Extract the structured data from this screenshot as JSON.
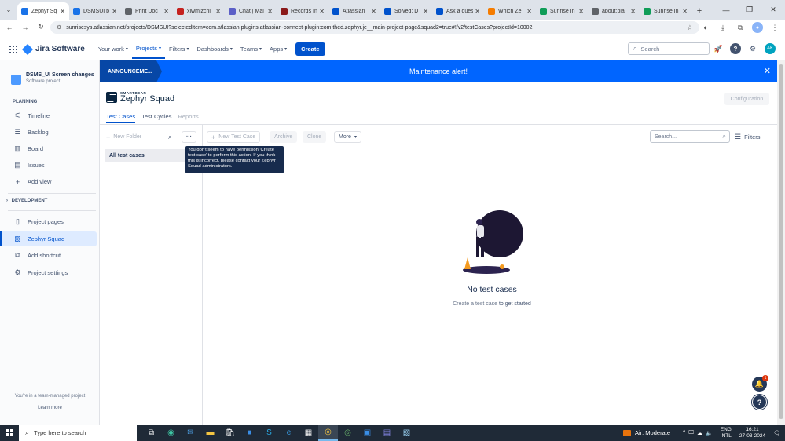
{
  "browser": {
    "tabs": [
      {
        "title": "Zephyr Sq",
        "active": true,
        "fav_color": "#1a73e8"
      },
      {
        "title": "DSMSUI b",
        "active": false,
        "fav_color": "#1a73e8"
      },
      {
        "title": "Print Doc",
        "active": false,
        "fav_color": "#5f6368"
      },
      {
        "title": "xlwmlzchi",
        "active": false,
        "fav_color": "#c5221f"
      },
      {
        "title": "Chat | Mai",
        "active": false,
        "fav_color": "#5b5fc7"
      },
      {
        "title": "Records In",
        "active": false,
        "fav_color": "#8b1a1a"
      },
      {
        "title": "Atlassian",
        "active": false,
        "fav_color": "#0052cc"
      },
      {
        "title": "Solved: D",
        "active": false,
        "fav_color": "#0052cc"
      },
      {
        "title": "Ask a ques",
        "active": false,
        "fav_color": "#0052cc"
      },
      {
        "title": "Which Ze",
        "active": false,
        "fav_color": "#f57c00"
      },
      {
        "title": "Sunrise In",
        "active": false,
        "fav_color": "#0f9d58"
      },
      {
        "title": "about:bla",
        "active": false,
        "fav_color": "#5f6368"
      },
      {
        "title": "Sunrise In",
        "active": false,
        "fav_color": "#0f9d58"
      }
    ],
    "url": "sunrisesys.atlassian.net/projects/DSMSUI?selectedItem=com.atlassian.plugins.atlassian-connect-plugin:com.thed.zephyr.je__main-project-page&squad2=true#!/v2/testCases?projectId=10002"
  },
  "jira": {
    "product": "Jira Software",
    "menu": [
      "Your work",
      "Projects",
      "Filters",
      "Dashboards",
      "Teams",
      "Apps"
    ],
    "active_menu": "Projects",
    "create": "Create",
    "search_placeholder": "Search",
    "user_initials": "AK"
  },
  "sidebar": {
    "project_name": "DSMS_UI Screen changes",
    "project_type": "Software project",
    "planning_heading": "PLANNING",
    "planning_items": [
      {
        "label": "Timeline",
        "icon": "timeline-icon"
      },
      {
        "label": "Backlog",
        "icon": "backlog-icon"
      },
      {
        "label": "Board",
        "icon": "board-icon"
      },
      {
        "label": "Issues",
        "icon": "issues-icon"
      },
      {
        "label": "Add view",
        "icon": "plus-icon"
      }
    ],
    "development_heading": "DEVELOPMENT",
    "other_items": [
      {
        "label": "Project pages",
        "icon": "page-icon"
      },
      {
        "label": "Zephyr Squad",
        "icon": "zephyr-icon",
        "active": true
      },
      {
        "label": "Add shortcut",
        "icon": "shortcut-icon"
      },
      {
        "label": "Project settings",
        "icon": "gear-icon"
      }
    ],
    "footer_text": "You're in a team-managed project",
    "learn_more": "Learn more"
  },
  "announcement": {
    "tag": "ANNOUNCEME...",
    "message": "Maintenance alert!"
  },
  "zephyr": {
    "brand_small": "SMARTBEAR",
    "brand": "Zephyr Squad",
    "configuration": "Configuration",
    "tabs": [
      "Test Cases",
      "Test Cycles",
      "Reports"
    ],
    "new_folder": "New Folder",
    "all_test_cases": "All test cases",
    "new_test_case": "New Test Case",
    "archive": "Archive",
    "clone": "Clone",
    "more": "More",
    "tooltip": "You don't seem to have permission 'Create test case' to perform this action. If you think this is incorrect, please contact your Zephyr Squad administrators.",
    "search_placeholder": "Search...",
    "filters": "Filters",
    "empty_title": "No test cases",
    "empty_link": "Create a test case",
    "empty_rest": "to get started",
    "notif_count": "1"
  },
  "taskbar": {
    "search_placeholder": "Type here to search",
    "weather": "Air: Moderate",
    "lang_line1": "ENG",
    "lang_line2": "INTL",
    "time": "16:21",
    "date": "27-03-2024"
  }
}
